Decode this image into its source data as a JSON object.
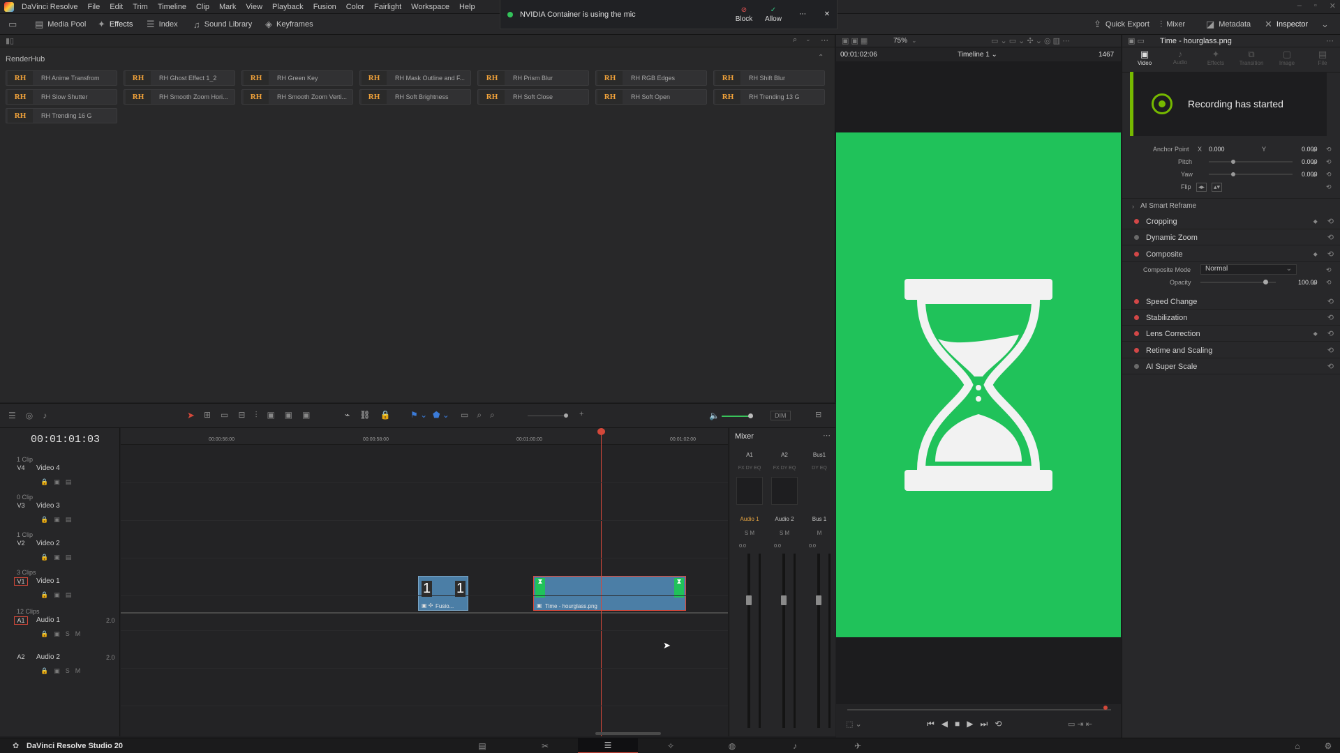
{
  "app": {
    "name": "DaVinci Resolve",
    "footer_name": "DaVinci Resolve Studio 20"
  },
  "menu": [
    "File",
    "Edit",
    "Trim",
    "Timeline",
    "Clip",
    "Mark",
    "View",
    "Playback",
    "Fusion",
    "Color",
    "Fairlight",
    "Workspace",
    "Help"
  ],
  "notification": {
    "text": "NVIDIA Container is using the mic",
    "block": "Block",
    "allow": "Allow"
  },
  "toolbar": {
    "media_pool": "Media Pool",
    "effects": "Effects",
    "index": "Index",
    "sound_library": "Sound Library",
    "keyframes": "Keyframes",
    "quick_export": "Quick Export",
    "mixer": "Mixer",
    "metadata": "Metadata",
    "inspector": "Inspector"
  },
  "effects_panel": {
    "section": "RenderHub",
    "tiles": [
      "RH Anime Transfrom",
      "RH Ghost Effect 1_2",
      "RH Green Key",
      "RH Mask Outline and F...",
      "RH Prism Blur",
      "RH RGB Edges",
      "RH Shift Blur",
      "RH Slow Shutter",
      "RH Smooth Zoom Hori...",
      "RH Smooth Zoom Verti...",
      "RH Soft Brightness",
      "RH Soft Close",
      "RH Soft Open",
      "RH Trending 13 G",
      "RH Trending 16 G"
    ],
    "thumb_text": "RH"
  },
  "viewer": {
    "zoom": "75%",
    "timecode": "00:01:02:06",
    "timeline_name": "Timeline 1",
    "frame": "1467"
  },
  "inspector": {
    "clip_title": "Time - hourglass.png",
    "tabs": [
      "Video",
      "Audio",
      "Effects",
      "Transition",
      "Image",
      "File"
    ],
    "params": {
      "anchor": {
        "label": "Anchor Point",
        "x_label": "X",
        "x": "0.000",
        "y_label": "Y",
        "y": "0.000"
      },
      "pitch": {
        "label": "Pitch",
        "value": "0.000"
      },
      "yaw": {
        "label": "Yaw",
        "value": "0.000"
      },
      "flip": {
        "label": "Flip"
      },
      "smart_reframe": "AI Smart Reframe"
    },
    "sections": [
      "Cropping",
      "Dynamic Zoom",
      "Composite",
      "Speed Change",
      "Stabilization",
      "Lens Correction",
      "Retime and Scaling",
      "AI Super Scale"
    ],
    "composite": {
      "mode_label": "Composite Mode",
      "mode_value": "Normal",
      "opacity_label": "Opacity",
      "opacity_value": "100.00"
    }
  },
  "toast": {
    "text": "Recording has started"
  },
  "timeline": {
    "timecode": "00:01:01:03",
    "dim": "DIM",
    "ruler": [
      "00:00:56:00",
      "00:00:58:00",
      "00:01:00:00",
      "00:01:02:00"
    ],
    "tracks": [
      {
        "id": "V4",
        "name": "Video 4",
        "clips": "1 Clip"
      },
      {
        "id": "V3",
        "name": "Video 3",
        "clips": "0 Clip"
      },
      {
        "id": "V2",
        "name": "Video 2",
        "clips": "1 Clip"
      },
      {
        "id": "V1",
        "name": "Video 1",
        "clips": "3 Clips"
      },
      {
        "id": "A1",
        "name": "Audio 1",
        "clips": "12 Clips",
        "ch": "2.0"
      },
      {
        "id": "A2",
        "name": "Audio 2",
        "clips": "",
        "ch": "2.0"
      }
    ],
    "clip_fusion": {
      "label": "Fusio...",
      "num_left": "1",
      "num_right": "1"
    },
    "clip_hourglass": {
      "label": "Time - hourglass.png"
    }
  },
  "mixer": {
    "title": "Mixer",
    "channels": [
      "A1",
      "A2",
      "Bus1"
    ],
    "channel_names": [
      "Audio 1",
      "Audio 2",
      "Bus 1"
    ],
    "level": "0.0"
  },
  "colors": {
    "accent_red": "#d4483a",
    "viewer_green": "#20c25a",
    "nvidia_green": "#76b900",
    "clip_blue": "#4b7ea6"
  }
}
